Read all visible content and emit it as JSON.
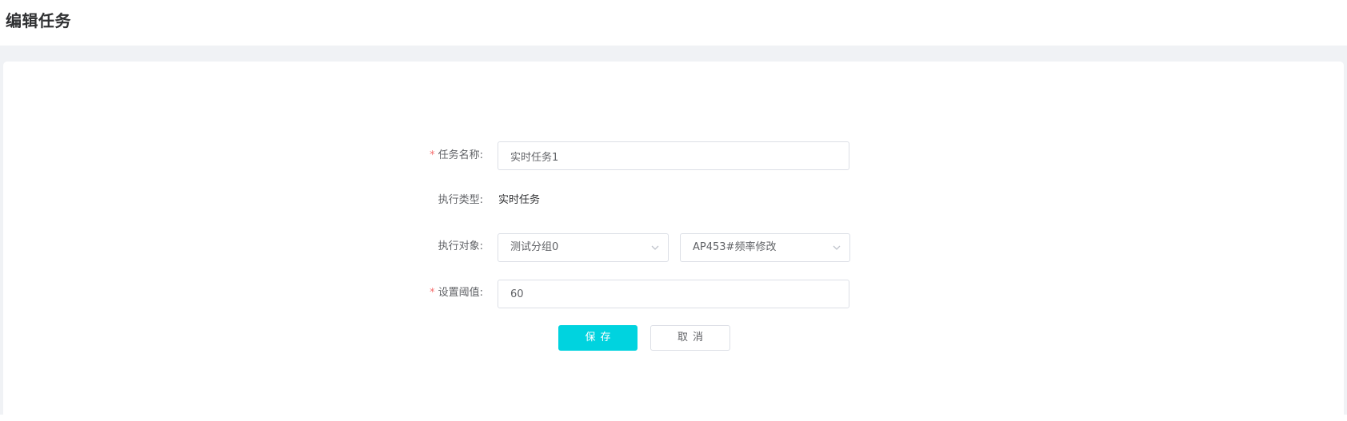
{
  "header": {
    "title": "编辑任务"
  },
  "form": {
    "task_name": {
      "required_mark": "*",
      "label": "任务名称:",
      "value": "实时任务1"
    },
    "exec_type": {
      "label": "执行类型:",
      "value": "实时任务"
    },
    "exec_target": {
      "label": "执行对象:",
      "group_select": {
        "value": "测试分组0",
        "icon": "chevron-down-icon"
      },
      "task_select": {
        "value": "AP453#频率修改",
        "icon": "chevron-down-icon"
      }
    },
    "threshold": {
      "required_mark": "*",
      "label": "设置阈值:",
      "value": "60"
    }
  },
  "actions": {
    "save_label": "保存",
    "cancel_label": "取消"
  },
  "colors": {
    "primary": "#00d3df",
    "required": "#f56c6c",
    "page_bg": "#f0f2f5",
    "border": "#dcdfe6"
  }
}
